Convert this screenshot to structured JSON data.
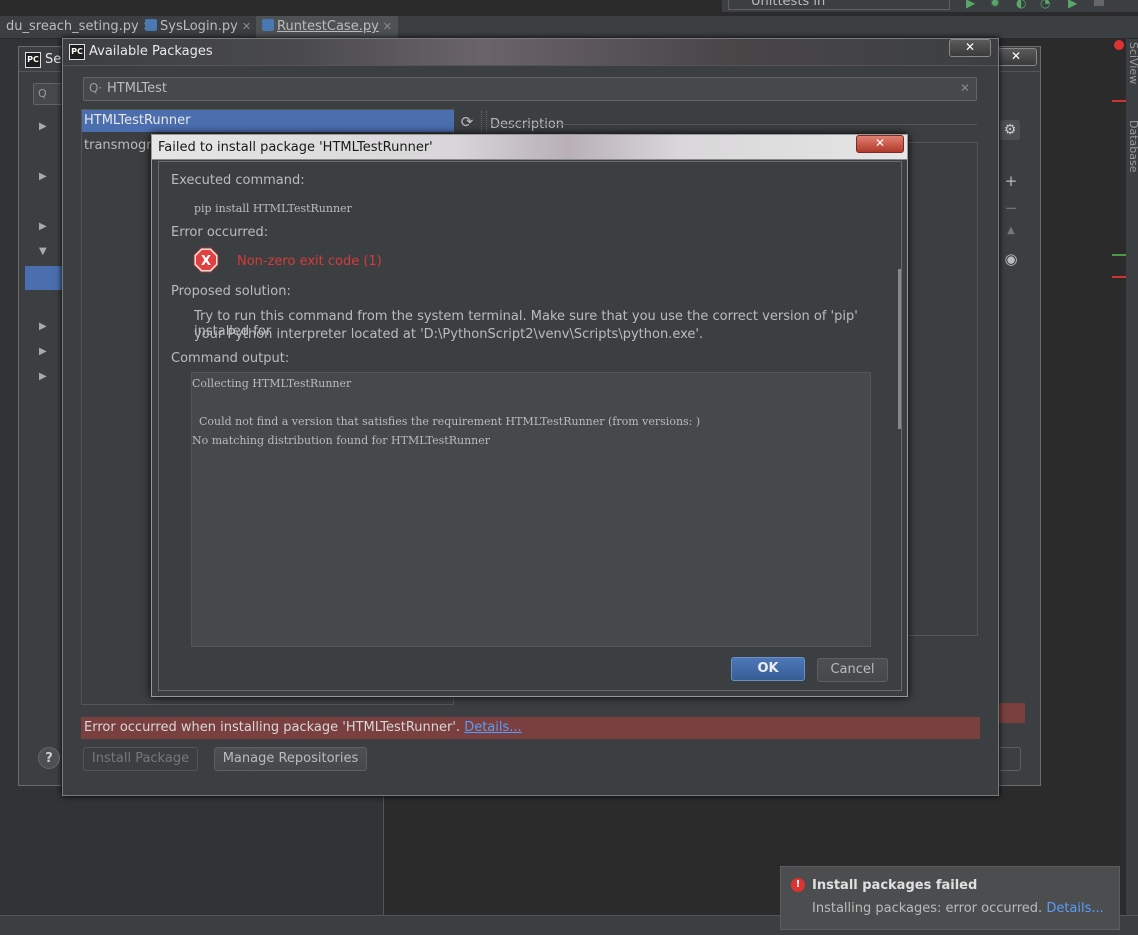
{
  "tabs": [
    {
      "label": "du_sreach_seting.py"
    },
    {
      "label": "SysLogin.py"
    },
    {
      "label": "RuntestCase.py"
    }
  ],
  "run_config": "Unittests in EnterpriseLogin.py",
  "side_strip": [
    "SciView",
    "Database"
  ],
  "settings": {
    "title_partial": "Se"
  },
  "available_packages": {
    "title": "Available Packages",
    "search_value": "HTMLTest",
    "packages": [
      "HTMLTestRunner",
      "transmogrif"
    ],
    "selected_index": 0,
    "description_label": "Description",
    "error_bar_text": "Error occurred when installing package 'HTMLTestRunner'.",
    "error_bar_link": "Details...",
    "install_button": "Install Package",
    "manage_button": "Manage Repositories",
    "help_symbol": "?"
  },
  "error_dialog": {
    "title": "Failed to install package 'HTMLTestRunner'",
    "executed_label": "Executed command:",
    "command": "pip install HTMLTestRunner",
    "error_label": "Error occurred:",
    "error_text": "Non-zero exit code (1)",
    "solution_label": "Proposed solution:",
    "solution_line1": "Try to run this command from the system terminal. Make sure that you use the correct version of 'pip' installed for",
    "solution_line2": "your Python interpreter located at 'D:\\PythonScript2\\venv\\Scripts\\python.exe'.",
    "output_label": "Command output:",
    "output_lines": [
      "Collecting HTMLTestRunner",
      "",
      "  Could not find a version that satisfies the requirement HTMLTestRunner (from versions: )",
      "No matching distribution found for HTMLTestRunner"
    ],
    "ok_label": "OK",
    "cancel_label": "Cancel"
  },
  "notification": {
    "title": "Install packages failed",
    "body": "Installing packages: error occurred.",
    "link": "Details..."
  },
  "colors": {
    "accent_selection": "#4b6eaf",
    "error_red": "#d63a3a",
    "error_bar": "#7a4040",
    "link": "#589df6"
  }
}
